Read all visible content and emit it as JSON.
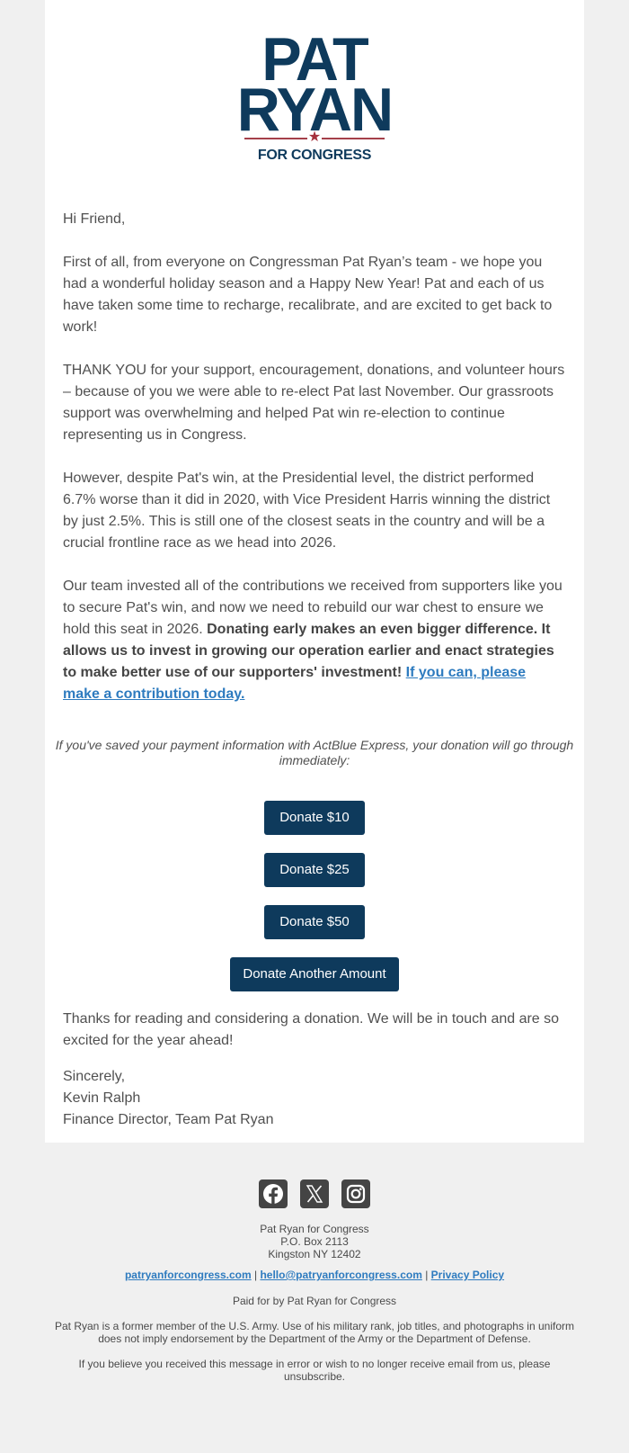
{
  "logo": {
    "line1": "PAT",
    "line2": "RYAN",
    "star": "★",
    "subtitle": "FOR CONGRESS",
    "brand_color": "#0e3a5c",
    "accent_color": "#a5303c"
  },
  "email": {
    "greeting": "Hi Friend,",
    "paragraphs": [
      "First of all, from everyone on Congressman Pat Ryan’s team - we hope you had a wonderful holiday season and a Happy New Year! Pat and each of us have taken some time to recharge, recalibrate, and are excited to get back to work!",
      "THANK YOU for your support, encouragement, donations, and volunteer hours – because of you we were able to re-elect Pat last November. Our grassroots support was overwhelming and helped Pat win re-election to continue representing us in Congress.",
      "However, despite Pat's win, at the Presidential level, the district performed 6.7% worse than it did in 2020, with Vice President Harris winning the district by just 2.5%. This is still one of the closest seats in the country and will be a crucial frontline race as we head into 2026."
    ],
    "appeal": {
      "plain": "Our team invested all of the contributions we received from supporters like you to secure Pat's win, and now we need to rebuild our war chest to ensure we hold this seat in 2026. ",
      "bold": "Donating early makes an even bigger difference. It allows us to invest in growing our operation earlier and enact strategies to make better use of our supporters' investment!",
      "link": "If you can, please make a contribution today. "
    },
    "express_note": "If you've saved your payment information with ActBlue Express, your donation will go through immediately:",
    "buttons": [
      {
        "label": "Donate $10"
      },
      {
        "label": "Donate $25"
      },
      {
        "label": "Donate $50"
      },
      {
        "label": "Donate Another Amount"
      }
    ],
    "closing": "Thanks for reading and considering a donation. We will be in touch and are so excited for the year ahead!",
    "signoff": "Sincerely,",
    "signer_name": "Kevin Ralph",
    "signer_title": "Finance Director, Team Pat Ryan",
    "button_color": "#0e3a5c",
    "link_color": "#2e7bbf"
  },
  "footer": {
    "social": [
      {
        "icon": "facebook-icon"
      },
      {
        "icon": "x-icon"
      },
      {
        "icon": "instagram-icon"
      }
    ],
    "org": "Pat Ryan for Congress",
    "address1": "P.O. Box 2113",
    "address2": "Kingston NY 12402",
    "links": {
      "website": "patryanforcongress.com",
      "email": "hello@patryanforcongress.com",
      "privacy": "Privacy Policy",
      "separator": " | "
    },
    "paid_for": "Paid for by Pat Ryan for Congress",
    "disclaimer": "Pat Ryan is a former member of the U.S. Army. Use of his military rank, job titles, and photographs in uniform does not imply endorsement by the Department of the Army or the Department of Defense.",
    "unsubscribe": "If you believe you received this message in error or wish to no longer receive email from us, please unsubscribe."
  }
}
